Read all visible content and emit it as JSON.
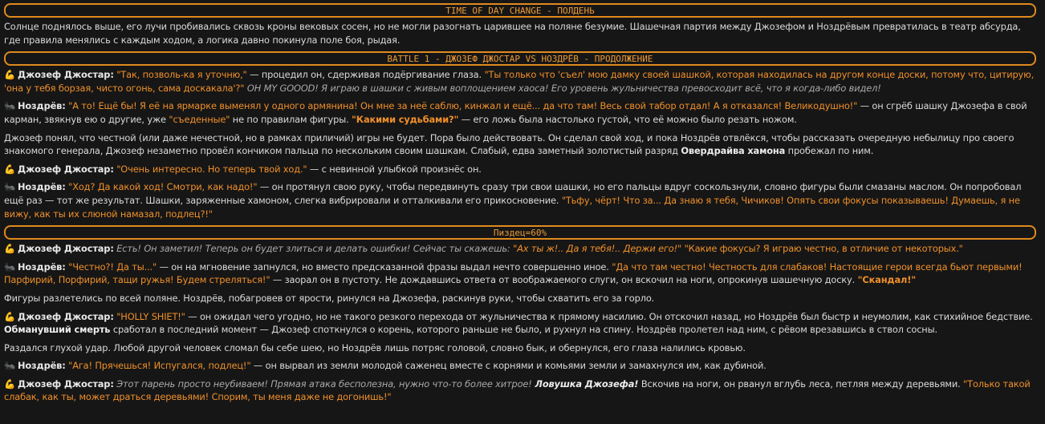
{
  "banners": {
    "time": "TIME OF DAY CHANGE - ПОЛДЕНЬ",
    "battle": "BATTLE 1 - ДЖОЗЕФ ДЖОСТАР VS НОЗДРЁВ - ПРОДОЛЖЕНИЕ",
    "meter": "Пиздец=60%"
  },
  "icons": {
    "joseph": "flexed-biceps-icon",
    "nozdrev": "ant-icon"
  },
  "speakers": {
    "joseph": "Джозеф Джостар:",
    "nozdrev": "Ноздрёв:"
  },
  "p01": {
    "text": "Солнце поднялось выше, его лучи пробивались сквозь кроны вековых сосен, но не могли разогнать царившее на поляне безумие. Шашечная партия между Джозефом и Ноздрёвым превратилась в театр абсурда, где правила менялись с каждым ходом, а логика давно покинула поле боя, рыдая."
  },
  "p02": {
    "q1": "\"Так, позволь-ка я уточню,\"",
    "t1": " — процедил он, сдерживая подёргивание глаза. ",
    "q2": "\"Ты только что 'съел' мою дамку своей шашкой, которая находилась на другом конце доски, потому что, цитирую, 'она у тебя борзая, чисто огонь, сама доскакала'?\"",
    "th": " OH MY GOOOD! Я играю в шашки с живым воплощением хаоса! Его уровень жульничества превосходит всё, что я когда-либо видел!"
  },
  "p03": {
    "q1": "\"А то! Ещё бы! Я её на ярмарке выменял у одного армянина! Он мне за неё саблю, кинжал и ещё... да что там! Весь свой табор отдал! А я отказался! Великодушно!\"",
    "t1": " — он сгрёб шашку Джозефа в свой карман, звякнув ею о другие, уже ",
    "q2": "\"съеденные\"",
    "t2": " не по правилам фигуры. ",
    "qb": "\"Какими судьбами?\"",
    "t3": " — его ложь была настолько густой, что её можно было резать ножом."
  },
  "p04": {
    "t1": "Джозеф понял, что честной (или даже нечестной, но в рамках приличий) игры не будет. Пора было действовать. Он сделал свой ход, и пока Ноздрёв отвлёкся, чтобы рассказать очередную небылицу про своего знакомого генерала, Джозеф незаметно провёл кончиком пальца по нескольким своим шашкам. Слабый, едва заметный золотистый разряд ",
    "b": "Овердрайва хамона",
    "t2": " пробежал по ним."
  },
  "p05": {
    "q1": "\"Очень интересно. Но теперь твой ход.\"",
    "t1": " — с невинной улыбкой произнёс он."
  },
  "p06": {
    "q1": "\"Ход? Да какой ход! Смотри, как надо!\"",
    "t1": " — он протянул свою руку, чтобы передвинуть сразу три свои шашки, но его пальцы вдруг соскользнули, словно фигуры были смазаны маслом. Он попробовал ещё раз — тот же результат. Шашки, заряженные хамоном, слегка вибрировали и отталкивали его прикосновение. ",
    "q2": "\"Тьфу, чёрт! Что за... Да знаю я тебя, Чичиков! Опять свои фокусы показываешь! Думаешь, я не вижу, как ты их слюной намазал, подлец?!\""
  },
  "p07": {
    "th1": "Есть! Он заметил! Теперь он будет злиться и делать ошибки! Сейчас ты скажешь: ",
    "thq": "\"Ах ты ж!.. Да я тебя!.. Держи его!\"",
    "q1": " \"Какие фокусы? Я играю честно, в отличие от некоторых.\""
  },
  "p08": {
    "q1": "\"Честно?! Да ты...\"",
    "t1": " — он на мгновение запнулся, но вместо предсказанной фразы выдал нечто совершенно иное. ",
    "q2": "\"Да что там честно! Честность для слабаков! Настоящие герои всегда бьют первыми! Парфирий, Порфирий, тащи ружья! Будем стреляться!\"",
    "t2": " — заорал он в пустоту. Не дождавшись ответа от воображаемого слуги, он вскочил на ноги, опрокинув шашечную доску. ",
    "qb": "\"Скандал!\""
  },
  "p09": {
    "text": "Фигуры разлетелись по всей поляне. Ноздрёв, побагровев от ярости, ринулся на Джозефа, раскинув руки, чтобы схватить его за горло."
  },
  "p10": {
    "q1": "\"HOLLY SHIET!\"",
    "t1": " — он ожидал чего угодно, но не такого резкого перехода от жульничества к прямому насилию. Он отскочил назад, но Ноздрёв был быстр и неумолим, как стихийное бедствие. ",
    "b": "Обманувший смерть",
    "t2": " сработал в последний момент — Джозеф споткнулся о корень, которого раньше не было, и рухнул на спину. Ноздрёв пролетел над ним, с рёвом врезавшись в ствол сосны."
  },
  "p11": {
    "text": "Раздался глухой удар. Любой другой человек сломал бы себе шею, но Ноздрёв лишь потряс головой, словно бык, и обернулся, его глаза налились кровью."
  },
  "p12": {
    "q1": "\"Ага! Прячешься! Испугался, подлец!\"",
    "t1": " — он вырвал из земли молодой саженец вместе с корнями и комьями земли и замахнулся им, как дубиной."
  },
  "p13": {
    "th1": "Этот парень просто неубиваем! Прямая атака бесполезна, нужно что-то более хитрое!",
    "thb": " Ловушка Джозефа!",
    "t1": " Вскочив на ноги, он рванул вглубь леса, петляя между деревьями. ",
    "q1": "\"Только такой слабак, как ты, может драться деревьями! Спорим, ты меня даже не догонишь!\""
  }
}
